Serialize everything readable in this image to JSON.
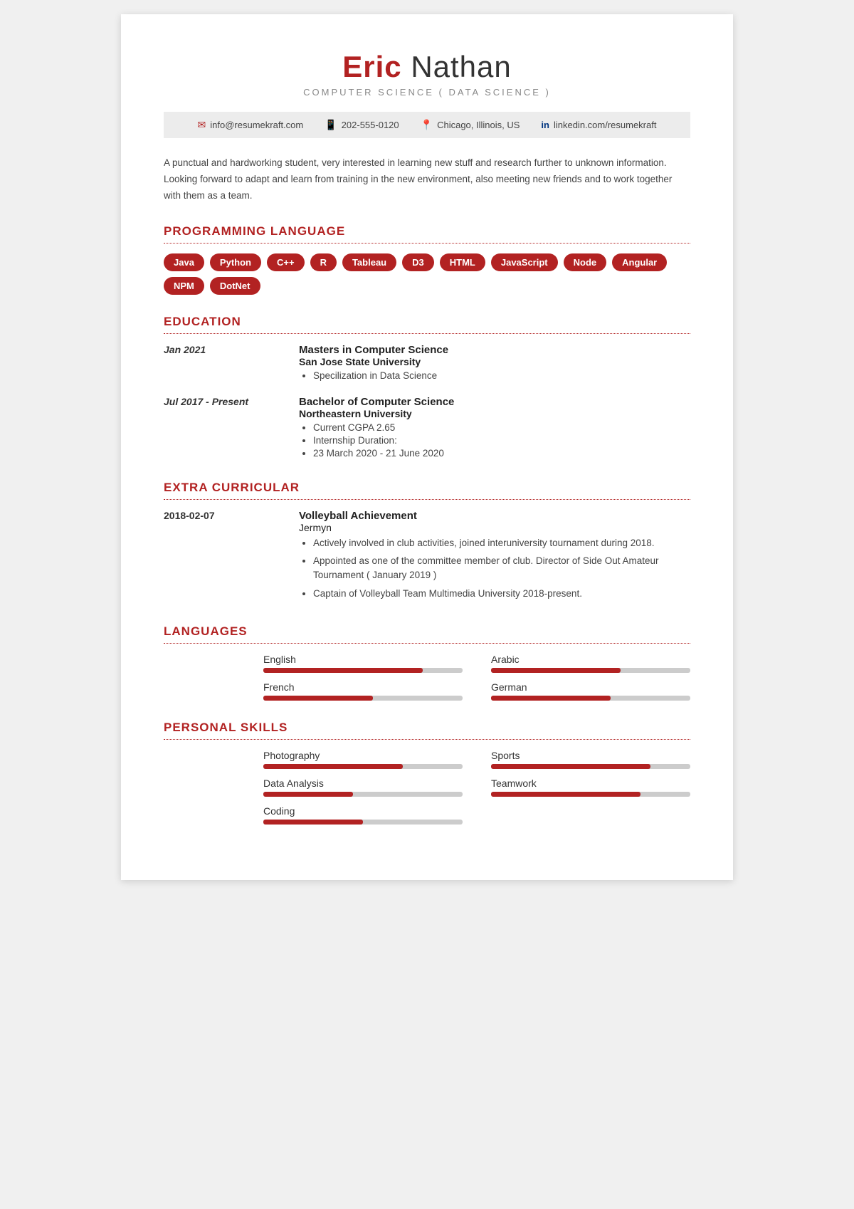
{
  "header": {
    "first_name": "Eric",
    "last_name": "Nathan",
    "subtitle": "COMPUTER SCIENCE ( DATA SCIENCE )"
  },
  "contact": {
    "email": "info@resumekraft.com",
    "phone": "202-555-0120",
    "location": "Chicago, Illinois, US",
    "linkedin": "linkedin.com/resumekraft"
  },
  "summary": "A punctual and hardworking student, very interested in learning new stuff and research further to unknown information. Looking forward to adapt and learn from training in the new environment, also meeting new friends and to work together with them as a team.",
  "sections": {
    "programming_language": {
      "title": "PROGRAMMING LANGUAGE",
      "tags": [
        "Java",
        "Python",
        "C++",
        "R",
        "Tableau",
        "D3",
        "HTML",
        "JavaScript",
        "Node",
        "Angular",
        "NPM",
        "DotNet"
      ]
    },
    "education": {
      "title": "EDUCATION",
      "entries": [
        {
          "date": "Jan 2021",
          "degree": "Masters in Computer Science",
          "institution": "San Jose State University",
          "bullets": [
            "Specilization in Data Science"
          ]
        },
        {
          "date": "Jul 2017 - Present",
          "degree": "Bachelor of Computer Science",
          "institution": "Northeastern University",
          "bullets": [
            "Current CGPA 2.65",
            "Internship Duration:",
            "23 March 2020 - 21 June 2020"
          ]
        }
      ]
    },
    "extra_curricular": {
      "title": "EXTRA CURRICULAR",
      "entries": [
        {
          "date": "2018-02-07",
          "title": "Volleyball Achievement",
          "org": "Jermyn",
          "bullets": [
            "Actively involved in club activities, joined interuniversity tournament during 2018.",
            "Appointed as one of the committee member of club. Director of Side Out Amateur Tournament ( January 2019 )",
            "Captain of Volleyball Team Multimedia University 2018-present."
          ]
        }
      ]
    },
    "languages": {
      "title": "LANGUAGES",
      "items": [
        {
          "label": "English",
          "percent": 80
        },
        {
          "label": "Arabic",
          "percent": 65
        },
        {
          "label": "French",
          "percent": 55
        },
        {
          "label": "German",
          "percent": 60
        }
      ]
    },
    "personal_skills": {
      "title": "PERSONAL SKILLS",
      "items": [
        {
          "label": "Photography",
          "percent": 70
        },
        {
          "label": "Sports",
          "percent": 80
        },
        {
          "label": "Data Analysis",
          "percent": 45
        },
        {
          "label": "Teamwork",
          "percent": 75
        },
        {
          "label": "Coding",
          "percent": 50
        }
      ]
    }
  }
}
